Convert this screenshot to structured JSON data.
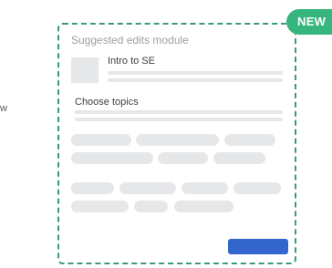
{
  "left_fragment": "w",
  "badge": {
    "label": "NEW"
  },
  "module": {
    "title": "Suggested edits module",
    "article_title": "Intro to SE",
    "section_title": "Choose topics"
  },
  "colors": {
    "accent_green": "#36b57f",
    "border_green": "#3a9a78",
    "primary_button": "#3366cc",
    "placeholder_gray": "#e6e7e9"
  }
}
